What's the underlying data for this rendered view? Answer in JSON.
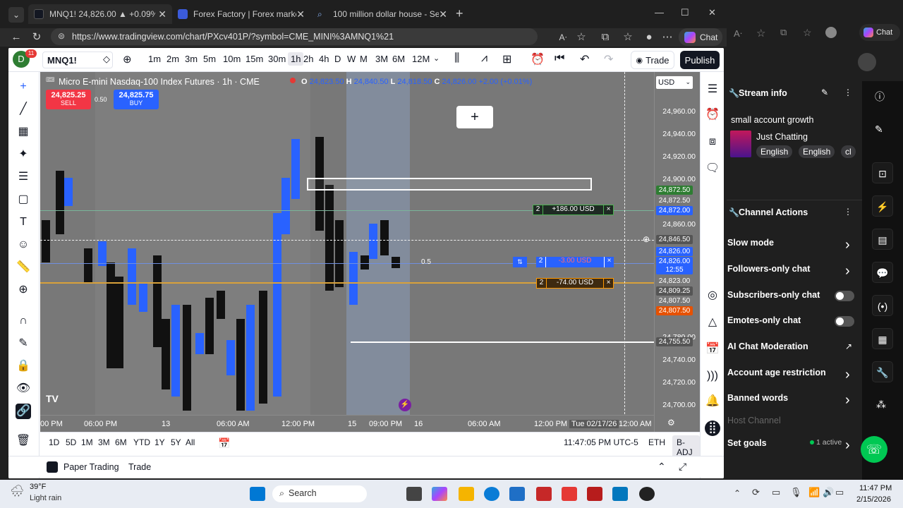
{
  "browser": {
    "tabs": [
      {
        "title": "MNQ1! 24,826.00 ▲ +0.09% Dtr",
        "active": true
      },
      {
        "title": "Forex Factory | Forex markets for",
        "active": false
      },
      {
        "title": "100 million dollar house - Search",
        "active": false
      }
    ],
    "url": "https://www.tradingview.com/chart/PXcv401P/?symbol=CME_MINI%3AMNQ1%21",
    "chat_label": "Chat",
    "window_controls": [
      "—",
      "☐",
      "✕"
    ]
  },
  "tv": {
    "avatar_letter": "D",
    "notif_count": "11",
    "symbol": "MNQ1!",
    "timeframes": [
      "1m",
      "2m",
      "3m",
      "5m",
      "10m",
      "15m",
      "30m",
      "1h",
      "2h",
      "4h",
      "D",
      "W",
      "M",
      "3M",
      "6M",
      "12M"
    ],
    "active_timeframe": "1h",
    "trade_label": "Trade",
    "publish_label": "Publish",
    "legend_title": "Micro E-mini Nasdaq-100 Index Futures · 1h · CME",
    "ohlc": {
      "o_label": "O",
      "o": "24,823.50",
      "h_label": "H",
      "h": "24,840.50",
      "l_label": "L",
      "l": "24,818.50",
      "c_label": "C",
      "c": "24,826.00",
      "chg": "+2.00 (+0.01%)"
    },
    "sell": {
      "price": "24,825.25",
      "label": "SELL"
    },
    "buy": {
      "price": "24,825.75",
      "label": "BUY"
    },
    "spread": "0.50",
    "currency": "USD",
    "price_labels": [
      "24,960.00",
      "24,940.00",
      "24,920.00",
      "24,900.00",
      "24,860.00",
      "24,780.00",
      "24,740.00",
      "24,720.00",
      "24,700.00"
    ],
    "price_tags": [
      {
        "text": "24,872.50",
        "color": "#2e7d32"
      },
      {
        "text": "24,872.50",
        "color": "#787878"
      },
      {
        "text": "24,872.00",
        "color": "#2962ff"
      },
      {
        "text": "24,846.50",
        "color": "#555"
      },
      {
        "text": "24,826.00",
        "color": "#2962ff"
      },
      {
        "text": "24,826.00",
        "color": "#2962ff"
      },
      {
        "text": "12:55",
        "color": "#2962ff"
      },
      {
        "text": "24,823.00",
        "color": "#787878"
      },
      {
        "text": "24,809.25",
        "color": "#555"
      },
      {
        "text": "24,807.50",
        "color": "#787878"
      },
      {
        "text": "24,807.50",
        "color": "#e65100"
      },
      {
        "text": "24,755.50",
        "color": "#555"
      }
    ],
    "time_labels": [
      "00 PM",
      "06:00 PM",
      "13",
      "06:00 AM",
      "12:00 PM",
      "15",
      "09:00 PM",
      "16",
      "06:00 AM",
      "12:00 PM",
      "Tue 02/17/26",
      "12:00 AM"
    ],
    "orders": [
      {
        "qty": "2",
        "text": "+186.00 USD",
        "close": "×"
      },
      {
        "qty": "2",
        "text": "-3.00 USD",
        "close": "×"
      },
      {
        "qty": "2",
        "text": "-74.00 USD",
        "close": "×"
      }
    ],
    "ratio_label": "0.5",
    "ranges": [
      "1D",
      "5D",
      "1M",
      "3M",
      "6M",
      "YTD",
      "1Y",
      "5Y",
      "All"
    ],
    "clock": "11:47:05 PM UTC-5",
    "eth": "ETH",
    "badj": "B-ADJ",
    "bottom_tabs": [
      "Paper Trading",
      "Trade"
    ]
  },
  "stream": {
    "stream_info": "Stream info",
    "title": "small account growth",
    "category": "Just Chatting",
    "tags": [
      "English",
      "English",
      "cl"
    ],
    "channel_actions": "Channel Actions",
    "actions": [
      {
        "label": "Slow mode",
        "kind": "chevron"
      },
      {
        "label": "Followers-only chat",
        "kind": "chevron"
      },
      {
        "label": "Subscribers-only chat",
        "kind": "toggle"
      },
      {
        "label": "Emotes-only chat",
        "kind": "toggle"
      },
      {
        "label": "AI Chat Moderation",
        "kind": "external"
      },
      {
        "label": "Account age restriction",
        "kind": "chevron"
      },
      {
        "label": "Banned words",
        "kind": "chevron"
      },
      {
        "label": "Host Channel",
        "kind": "disabled"
      },
      {
        "label": "Set goals",
        "kind": "chevron"
      }
    ],
    "active_badge": "1 active"
  },
  "taskbar": {
    "weather_temp": "39°F",
    "weather_desc": "Light rain",
    "search": "Search",
    "time": "11:47 PM",
    "date": "2/15/2026"
  }
}
